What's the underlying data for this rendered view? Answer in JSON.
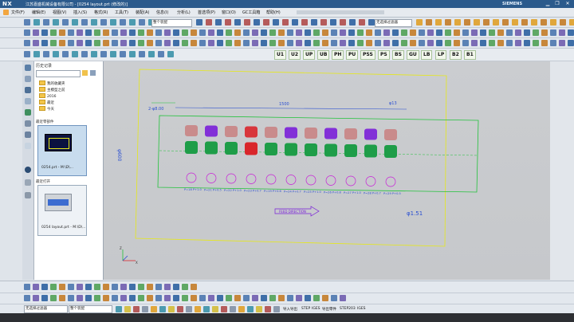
{
  "window": {
    "app_logo": "NX",
    "title": "江苏嘉盛机械设备有限公司 - [0254 layout.prt (修改的)]",
    "brand": "SIEMENS",
    "controls": [
      "▁",
      "❐",
      "✕"
    ]
  },
  "menu": [
    "文件(F)",
    "编辑(E)",
    "视图(V)",
    "插入(S)",
    "格式(R)",
    "工具(T)",
    "装配(A)",
    "信息(I)",
    "分析(L)",
    "首选项(P)",
    "窗口(O)",
    "GC工具箱",
    "帮助(H)"
  ],
  "toolbar": {
    "filter_combo": "整个装配",
    "selection_combo": "无选择过滤器",
    "view_combo": "静态线框"
  },
  "macro_buttons": [
    "U1",
    "U2",
    "UP",
    "UB",
    "PH",
    "PU",
    "PSS",
    "PS",
    "BS",
    "GU",
    "LB",
    "LP",
    "B2",
    "B1"
  ],
  "navigator": {
    "title": "历史记录",
    "combo": "",
    "tree": [
      "我的收藏夹",
      "主模型之前",
      "2016",
      "最近",
      "今天"
    ],
    "section_today": "最近零部件",
    "section_recent": "最近打开",
    "thumbs": [
      {
        "caption": "0254.prt  -  M:\\D\\..."
      },
      {
        "caption": "0254 layout.prt - M:\\D\\..."
      }
    ]
  },
  "drawing": {
    "top_dim": "1500",
    "ref_dim": "2-φ8.00",
    "side_text": "φ13",
    "left_text": "φ600",
    "feed_label": "FEED DIRECTION",
    "part_label": "φ1.51",
    "station_tags": [
      "P=18 P+1.0",
      "P=21 P+0.5",
      "P=22 P+1.0",
      "P=23 P+0.7",
      "P=19 P+0.6",
      "P=24 P+0.7",
      "P=25 P+1.0",
      "P=26 P+0.8",
      "P=27 P+1.0",
      "P=28 P+0.7",
      "P=29 P+0.5"
    ]
  },
  "bottom": {
    "snap_combo": "无选择过滤器",
    "layer_combo": "整个装配",
    "export_buttons": [
      "导入导出",
      "STEP",
      "IGES",
      "导出零件",
      "STEP203",
      "IGES"
    ]
  },
  "colors": {
    "title_bar": "#2b5a8c",
    "grid_green": "#21c23a",
    "dim_blue": "#2a4fd1",
    "part_red": "#d9262b",
    "part_purple": "#7a1fd8",
    "part_green": "#1e9d48",
    "boundary_yellow": "#e6e81a"
  }
}
